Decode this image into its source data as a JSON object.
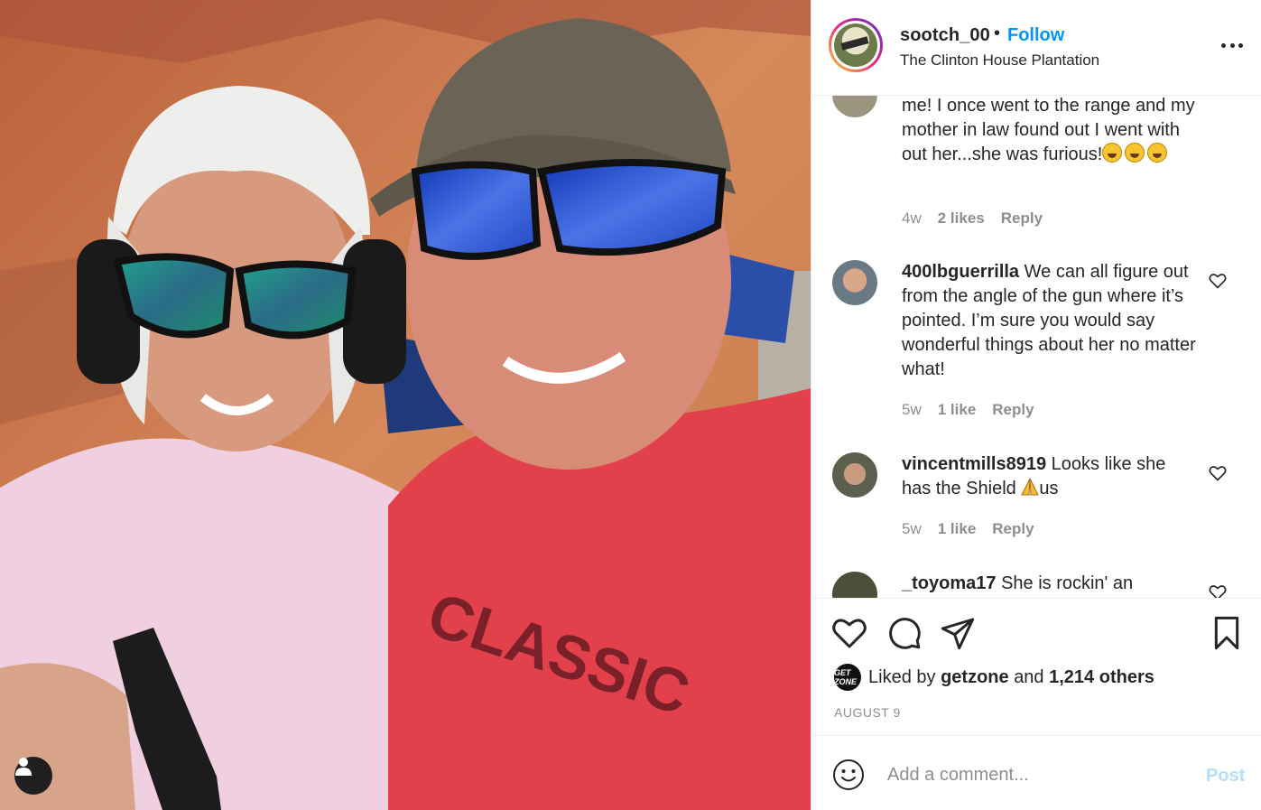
{
  "header": {
    "username": "sootch_00",
    "separator": "•",
    "follow_label": "Follow",
    "location": "The Clinton House Plantation",
    "more_icon": "more-options-icon"
  },
  "comments": [
    {
      "username": "",
      "text": "me! I once went to the range and my mother in law found out I went with out her...she was furious!",
      "emoji_count": 3,
      "time": "4w",
      "likes": "2 likes",
      "reply": "Reply"
    },
    {
      "username": "400lbguerrilla",
      "text": "We can all figure out from the angle of the gun where it’s pointed. I’m sure you would say wonderful things about her no matter what!",
      "time": "5w",
      "likes": "1 like",
      "reply": "Reply"
    },
    {
      "username": "vincentmills8919",
      "text": "Looks like she has the Shield",
      "text_after_emoji": "us",
      "time": "5w",
      "likes": "1 like",
      "reply": "Reply"
    },
    {
      "username": "_toyoma17",
      "text": "She is rockin' an"
    }
  ],
  "actions": {
    "like_icon": "heart-icon",
    "comment_icon": "comment-icon",
    "share_icon": "share-icon",
    "save_icon": "bookmark-icon"
  },
  "likes": {
    "avatar_text": "GET ZONE",
    "prefix": "Liked by",
    "user": "getzone",
    "joiner": "and",
    "others": "1,214 others"
  },
  "date": "AUGUST 9",
  "add_comment": {
    "placeholder": "Add a comment...",
    "post_label": "Post"
  },
  "colors": {
    "accent": "#0095f6",
    "post_disabled": "#b2dffc",
    "muted": "#8e8e8e",
    "text": "#262626"
  }
}
